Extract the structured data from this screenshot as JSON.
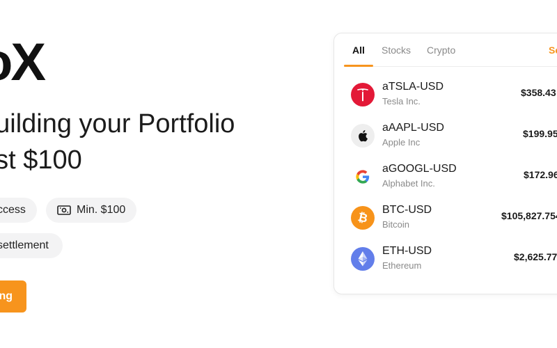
{
  "hero": {
    "brand": "oX",
    "headline_line1": "building your Portfolio",
    "headline_line2": "ust $100",
    "chips": {
      "access": "ccess",
      "min": "Min. $100",
      "settlement": "settlement"
    },
    "cta_label": "ng"
  },
  "card": {
    "tabs": [
      "All",
      "Stocks",
      "Crypto"
    ],
    "see_label": "Se",
    "active_tab": "All",
    "assets": [
      {
        "symbol": "aTSLA-USD",
        "name": "Tesla Inc.",
        "price": "$358.43",
        "logo": "tesla-icon",
        "color": "#e31937"
      },
      {
        "symbol": "aAAPL-USD",
        "name": "Apple Inc",
        "price": "$199.95",
        "logo": "apple-icon",
        "color": "#eeeeee"
      },
      {
        "symbol": "aGOOGL-USD",
        "name": "Alphabet Inc.",
        "price": "$172.96",
        "logo": "google-icon",
        "color": "#ffffff"
      },
      {
        "symbol": "BTC-USD",
        "name": "Bitcoin",
        "price": "$105,827.754",
        "logo": "bitcoin-icon",
        "color": "#f7931a"
      },
      {
        "symbol": "ETH-USD",
        "name": "Ethereum",
        "price": "$2,625.77",
        "logo": "ethereum-icon",
        "color": "#627eea"
      }
    ]
  },
  "colors": {
    "accent": "#f7941d"
  }
}
